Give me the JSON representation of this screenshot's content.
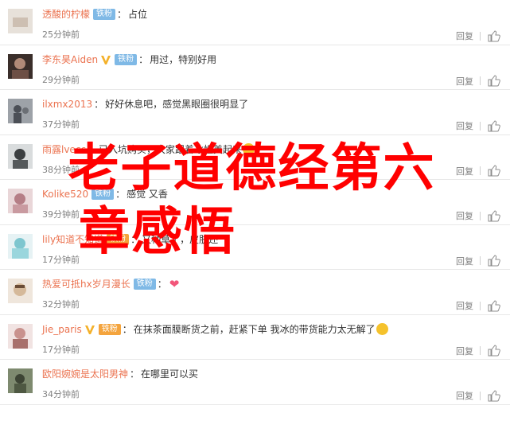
{
  "comments": [
    {
      "user": "透酸的柠檬",
      "verified": false,
      "badge": "铁粉",
      "badge_style": "blue",
      "text": "占位",
      "time": "25分钟前",
      "reply": "回复",
      "avatar_color": "#d9d3cc"
    },
    {
      "user": "李东昊Aiden",
      "verified": true,
      "badge": "铁粉",
      "badge_style": "blue",
      "text": "用过，特别好用",
      "time": "29分钟前",
      "reply": "回复",
      "avatar_color": "#8a6a5a"
    },
    {
      "user": "ilxmx2013",
      "verified": false,
      "badge": "",
      "badge_style": "",
      "text": "好好休息吧，感觉黑眼圈很明显了",
      "time": "37分钟前",
      "reply": "回复",
      "avatar_color": "#7d8088"
    },
    {
      "user": "雨露lvecc",
      "verified": false,
      "badge": "",
      "badge_style": "",
      "text": "已入坑购买，大家跟着冰姐美起来",
      "time": "38分钟前",
      "reply": "回复",
      "avatar_color": "#575b5e"
    },
    {
      "user": "Kolike520",
      "verified": false,
      "badge": "铁粉",
      "badge_style": "blue",
      "text": "感觉 又香",
      "time": "39分钟前",
      "reply": "回复",
      "avatar_color": "#c7a4a9"
    },
    {
      "user": "lily知道不知道",
      "verified": false,
      "badge": "铁粉",
      "badge_style": "gold",
      "text": "又种草了，皮肤还",
      "time": "17分钟前",
      "reply": "回复",
      "avatar_color": "#8fd0d6"
    },
    {
      "user": "热爱可抵hx岁月漫长",
      "verified": false,
      "badge": "铁粉",
      "badge_style": "blue",
      "text": "",
      "time": "32分钟前",
      "reply": "回复",
      "avatar_color": "#c9b29a"
    },
    {
      "user": "Jie_paris",
      "verified": true,
      "badge": "铁粉",
      "badge_style": "gold",
      "text": "在抹茶面膜断货之前，赶紧下单 我冰的带货能力太无解了",
      "time": "17分钟前",
      "reply": "回复",
      "avatar_color": "#d3a9a6"
    },
    {
      "user": "欧阳婉婉是太阳男神",
      "verified": false,
      "badge": "",
      "badge_style": "",
      "text": "在哪里可以买",
      "time": "34分钟前",
      "reply": "回复",
      "avatar_color": "#6c7861"
    }
  ],
  "overlay": {
    "line1": "老子道德经第六",
    "line2": "章感悟"
  },
  "colors": {
    "username": "#eb7350",
    "overlay": "#ff0000",
    "badge_blue": "#7fb9e6",
    "badge_gold": "#f4a43d"
  }
}
